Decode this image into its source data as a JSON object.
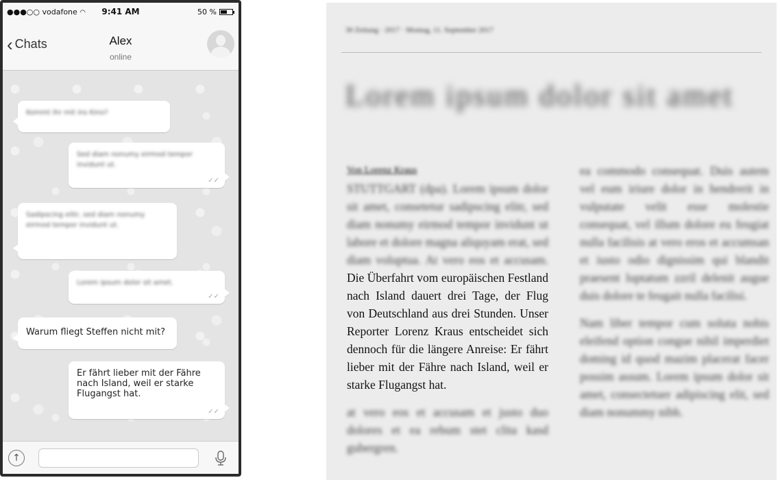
{
  "phone": {
    "status_bar": {
      "carrier": "●●●○○ vodafone",
      "time": "9:41 AM",
      "battery": "50 %",
      "battery_level": 0.5
    },
    "header": {
      "back_label": "Chats",
      "contact_name": "Alex",
      "contact_status": "online"
    },
    "messages": [
      {
        "direction": "in",
        "text": "Kommt Ihr mit ins Kino?",
        "blurred": true
      },
      {
        "direction": "out",
        "text": "Sed diam nonumy eirmod tempor invidunt ut.",
        "blurred": true,
        "read": true
      },
      {
        "direction": "in",
        "text": "Sadipscing elitr, sed diam nonumy eirmod tempor invidunt ut.",
        "blurred": true
      },
      {
        "direction": "out",
        "text": "Lorem ipsum dolor sit amet.",
        "blurred": true,
        "read": true
      },
      {
        "direction": "in",
        "text": "Warum fliegt Steffen nicht mit?",
        "blurred": false
      },
      {
        "direction": "out",
        "text": "Er fährt lieber mit der Fähre nach Island, weil er starke Flugangst hat.",
        "blurred": false,
        "read": true
      }
    ],
    "input": {
      "placeholder": ""
    }
  },
  "newspaper": {
    "header_line": "30 Zeitung · 2017 · Montag, 11. September 2017",
    "headline": "Lorem ipsum dolor sit amet",
    "byline": "Von Lorenz Kraus",
    "left_blurred_intro": "STUTTGART (dpa). Lorem ipsum dolor sit amet, consetetur sadipscing elitr, sed diam nonumy eirmod tempor invidunt ut labore et dolore magna aliquyam erat, sed diam voluptua. At vero eos et accusam.",
    "left_clear": "Die Überfahrt vom europäischen Festland nach Island dauert drei Tage, der Flug von Deutschland aus drei Stunden. Unser Reporter Lorenz Kraus entscheidet sich dennoch für die längere Anreise: Er fährt lieber mit der Fähre nach Island, weil er starke Flugangst hat.",
    "left_blurred_outro": "at vero eos et accusam et justo duo dolores et ea rebum stet clita kasd gubergren.",
    "right_blurred_1": "ea commodo consequat. Duis autem vel eum iriure dolor in hendrerit in vulputate velit esse molestie consequat, vel illum dolore eu feugiat nulla facilisis at vero eros et accumsan et iusto odio dignissim qui blandit praesent luptatum zzril delenit augue duis dolore te feugait nulla facilisi.",
    "right_blurred_2": "Nam liber tempor cum soluta nobis eleifend option congue nihil imperdiet doming id quod mazim placerat facer possim assum. Lorem ipsum dolor sit amet, consectetuer adipiscing elit, sed diam nonummy nibh."
  }
}
